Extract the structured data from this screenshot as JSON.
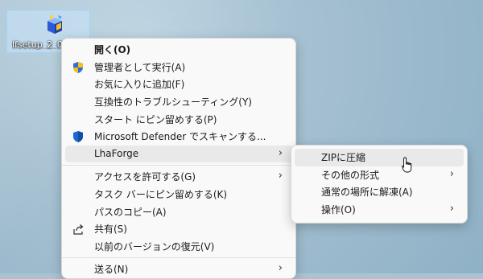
{
  "desktop_icon": {
    "label": "lfsetup_2_0",
    "icon": "setup-package-icon"
  },
  "context_menu": {
    "items": [
      {
        "label": "開く(O)",
        "bold": true
      },
      {
        "label": "管理者として実行(A)",
        "icon": "uac-shield-icon"
      },
      {
        "label": "お気に入りに追加(F)"
      },
      {
        "label": "互換性のトラブルシューティング(Y)"
      },
      {
        "label": "スタート にピン留めする(P)"
      },
      {
        "label": "Microsoft Defender でスキャンする...",
        "icon": "defender-shield-icon"
      },
      {
        "label": "LhaForge",
        "has_submenu": true,
        "highlighted": true
      },
      {
        "label": "アクセスを許可する(G)",
        "has_submenu": true
      },
      {
        "label": "タスク バーにピン留めする(K)"
      },
      {
        "label": "パスのコピー(A)"
      },
      {
        "label": "共有(S)",
        "icon": "share-icon"
      },
      {
        "label": "以前のバージョンの復元(V)"
      },
      {
        "label": "送る(N)",
        "has_submenu": true
      }
    ]
  },
  "submenu": {
    "items": [
      {
        "label": "ZIPに圧縮",
        "highlighted": true
      },
      {
        "label": "その他の形式",
        "has_submenu": true
      },
      {
        "label": "通常の場所に解凍(A)"
      },
      {
        "label": "操作(O)",
        "has_submenu": true
      }
    ]
  },
  "colors": {
    "menu_bg": "#f9f9f9",
    "hover_bg": "#e9e9e9",
    "uac_blue": "#2f6fd1",
    "uac_yellow": "#f3c11b",
    "defender_blue": "#1c6ad1"
  },
  "chevron": "›"
}
